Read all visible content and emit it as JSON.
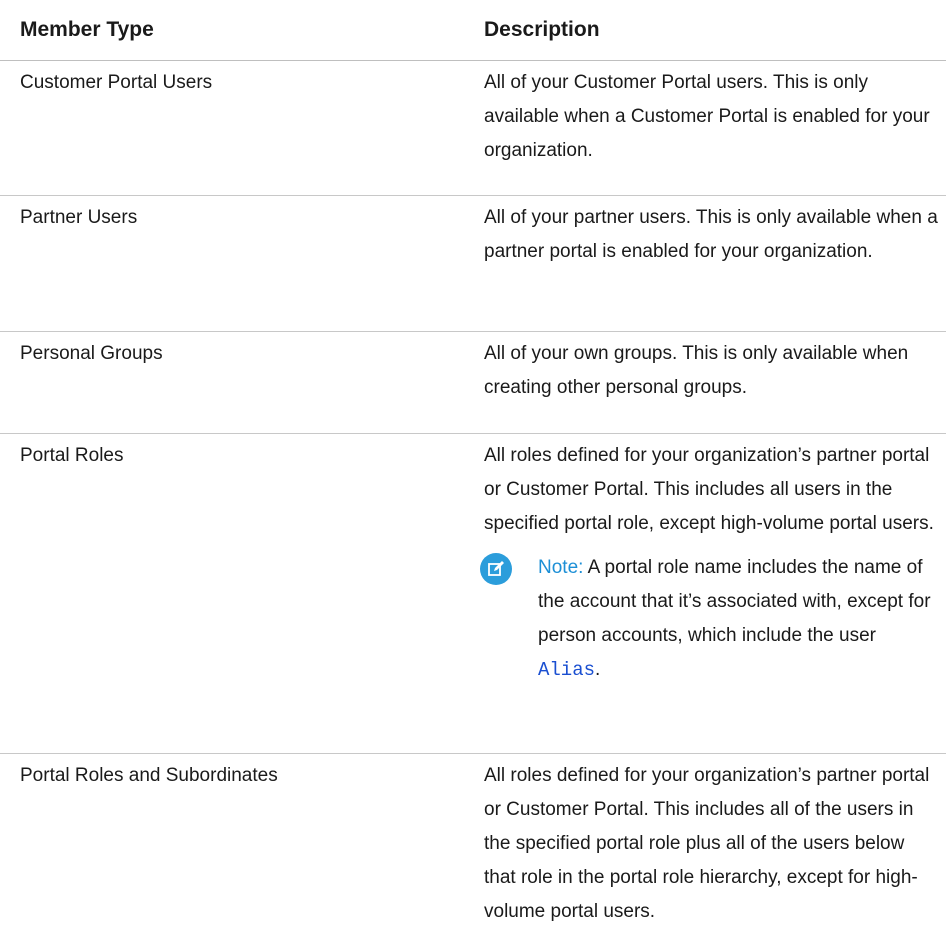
{
  "table": {
    "headers": {
      "member_type": "Member Type",
      "description": "Description"
    },
    "rows": [
      {
        "member_type": "Customer Portal Users",
        "description": "All of your Customer Portal users. This is only available when a Customer Portal is enabled for your organization."
      },
      {
        "member_type": "Partner Users",
        "description": "All of your partner users. This is only available when a partner portal is enabled for your organization."
      },
      {
        "member_type": "Personal Groups",
        "description": "All of your own groups. This is only available when creating other personal groups."
      },
      {
        "member_type": "Portal Roles",
        "description": "All roles defined for your organization’s partner portal or Customer Portal. This includes all users in the specified portal role, except high-volume portal users.",
        "note": {
          "label": "Note:",
          "text": "A portal role name includes the name of the account that it’s associated with, except for person accounts, which include the user",
          "code": "Alias",
          "trailing": ".",
          "icon": "edit-note-icon"
        }
      },
      {
        "member_type": "Portal Roles and Subordinates",
        "description": "All roles defined for your organization’s partner portal or Customer Portal. This includes all of the users in the specified portal role plus all of the users below that role in the portal role hierarchy, except for high-volume portal users."
      }
    ]
  },
  "colors": {
    "note_accent": "#1c8fd6",
    "code_link": "#1a4fd1",
    "icon_bg": "#2b9ddb"
  }
}
